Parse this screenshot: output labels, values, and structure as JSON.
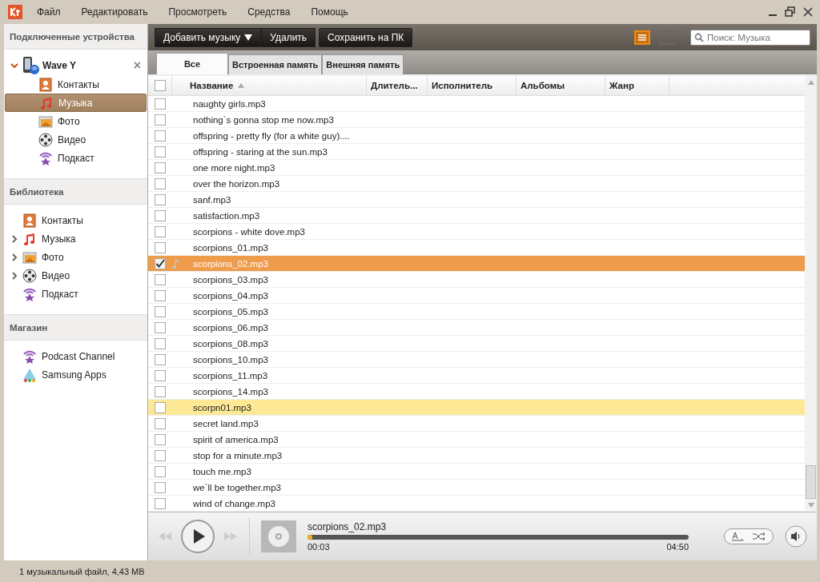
{
  "window": {
    "menu": [
      "Файл",
      "Редактировать",
      "Просмотреть",
      "Средства",
      "Помощь"
    ]
  },
  "sidebar": {
    "sections": [
      {
        "title": "Подключенные устройства",
        "device": {
          "name": "Wave Y",
          "expanded": true,
          "close": "×"
        },
        "items": [
          {
            "label": "Контакты",
            "kind": "contacts",
            "selected": false,
            "expandable": false
          },
          {
            "label": "Музыка",
            "kind": "music",
            "selected": true,
            "expandable": false
          },
          {
            "label": "Фото",
            "kind": "photo",
            "selected": false,
            "expandable": false
          },
          {
            "label": "Видео",
            "kind": "video",
            "selected": false,
            "expandable": false
          },
          {
            "label": "Подкаст",
            "kind": "podcast",
            "selected": false,
            "expandable": false
          }
        ]
      },
      {
        "title": "Библиотека",
        "items": [
          {
            "label": "Контакты",
            "kind": "contacts",
            "selected": false,
            "expandable": false
          },
          {
            "label": "Музыка",
            "kind": "music",
            "selected": false,
            "expandable": true
          },
          {
            "label": "Фото",
            "kind": "photo",
            "selected": false,
            "expandable": true
          },
          {
            "label": "Видео",
            "kind": "video",
            "selected": false,
            "expandable": true
          },
          {
            "label": "Подкаст",
            "kind": "podcast",
            "selected": false,
            "expandable": false
          }
        ]
      },
      {
        "title": "Магазин",
        "items": [
          {
            "label": "Podcast Channel",
            "kind": "podcast",
            "selected": false,
            "expandable": false
          },
          {
            "label": "Samsung Apps",
            "kind": "apps",
            "selected": false,
            "expandable": false
          }
        ]
      }
    ]
  },
  "toolbar": {
    "buttons": [
      {
        "label": "Добавить музыку",
        "dropdown": true
      },
      {
        "label": "Удалить",
        "dropdown": false
      },
      {
        "label": "Сохранить на ПК",
        "dropdown": false
      }
    ],
    "views": [
      {
        "kind": "list",
        "selected": true
      },
      {
        "kind": "grid",
        "selected": false
      }
    ],
    "search": {
      "placeholder": "Поиск: Музыка"
    }
  },
  "tabs": [
    {
      "label": "Все",
      "selected": true
    },
    {
      "label": "Встроенная память",
      "selected": false
    },
    {
      "label": "Внешняя память",
      "selected": false
    }
  ],
  "table": {
    "select_all_checked": false,
    "columns": [
      {
        "label": "Название",
        "sorted": true
      },
      {
        "label": "Длитель...",
        "sorted": false
      },
      {
        "label": "Исполнитель",
        "sorted": false
      },
      {
        "label": "Альбомы",
        "sorted": false
      },
      {
        "label": "Жанр",
        "sorted": false
      }
    ],
    "rows": [
      {
        "name": "naughty girls.mp3",
        "checked": false,
        "selected": false,
        "highlighted": false,
        "playing": false
      },
      {
        "name": "nothing`s gonna stop me now.mp3",
        "checked": false,
        "selected": false,
        "highlighted": false,
        "playing": false
      },
      {
        "name": "offspring - pretty fly (for a white guy)....",
        "checked": false,
        "selected": false,
        "highlighted": false,
        "playing": false
      },
      {
        "name": "offspring - staring at the sun.mp3",
        "checked": false,
        "selected": false,
        "highlighted": false,
        "playing": false
      },
      {
        "name": "one more night.mp3",
        "checked": false,
        "selected": false,
        "highlighted": false,
        "playing": false
      },
      {
        "name": "over the horizon.mp3",
        "checked": false,
        "selected": false,
        "highlighted": false,
        "playing": false
      },
      {
        "name": "sanf.mp3",
        "checked": false,
        "selected": false,
        "highlighted": false,
        "playing": false
      },
      {
        "name": "satisfaction.mp3",
        "checked": false,
        "selected": false,
        "highlighted": false,
        "playing": false
      },
      {
        "name": "scorpions - white dove.mp3",
        "checked": false,
        "selected": false,
        "highlighted": false,
        "playing": false
      },
      {
        "name": "scorpions_01.mp3",
        "checked": false,
        "selected": false,
        "highlighted": false,
        "playing": false
      },
      {
        "name": "scorpions_02.mp3",
        "checked": true,
        "selected": true,
        "highlighted": false,
        "playing": true
      },
      {
        "name": "scorpions_03.mp3",
        "checked": false,
        "selected": false,
        "highlighted": false,
        "playing": false
      },
      {
        "name": "scorpions_04.mp3",
        "checked": false,
        "selected": false,
        "highlighted": false,
        "playing": false
      },
      {
        "name": "scorpions_05.mp3",
        "checked": false,
        "selected": false,
        "highlighted": false,
        "playing": false
      },
      {
        "name": "scorpions_06.mp3",
        "checked": false,
        "selected": false,
        "highlighted": false,
        "playing": false
      },
      {
        "name": "scorpions_08.mp3",
        "checked": false,
        "selected": false,
        "highlighted": false,
        "playing": false
      },
      {
        "name": "scorpions_10.mp3",
        "checked": false,
        "selected": false,
        "highlighted": false,
        "playing": false
      },
      {
        "name": "scorpions_11.mp3",
        "checked": false,
        "selected": false,
        "highlighted": false,
        "playing": false
      },
      {
        "name": "scorpions_14.mp3",
        "checked": false,
        "selected": false,
        "highlighted": false,
        "playing": false
      },
      {
        "name": "scorpn01.mp3",
        "checked": false,
        "selected": false,
        "highlighted": true,
        "playing": false
      },
      {
        "name": "secret land.mp3",
        "checked": false,
        "selected": false,
        "highlighted": false,
        "playing": false
      },
      {
        "name": "spirit of america.mp3",
        "checked": false,
        "selected": false,
        "highlighted": false,
        "playing": false
      },
      {
        "name": "stop for a minute.mp3",
        "checked": false,
        "selected": false,
        "highlighted": false,
        "playing": false
      },
      {
        "name": "touch me.mp3",
        "checked": false,
        "selected": false,
        "highlighted": false,
        "playing": false
      },
      {
        "name": "we`ll be together.mp3",
        "checked": false,
        "selected": false,
        "highlighted": false,
        "playing": false
      },
      {
        "name": "wind of change.mp3",
        "checked": false,
        "selected": false,
        "highlighted": false,
        "playing": false
      }
    ]
  },
  "player": {
    "title": "scorpions_02.mp3",
    "level": 0.005,
    "elapsed": "00:03",
    "total": "04:50"
  },
  "status_bar": "1 музыкальный файл, 4,43 MB"
}
